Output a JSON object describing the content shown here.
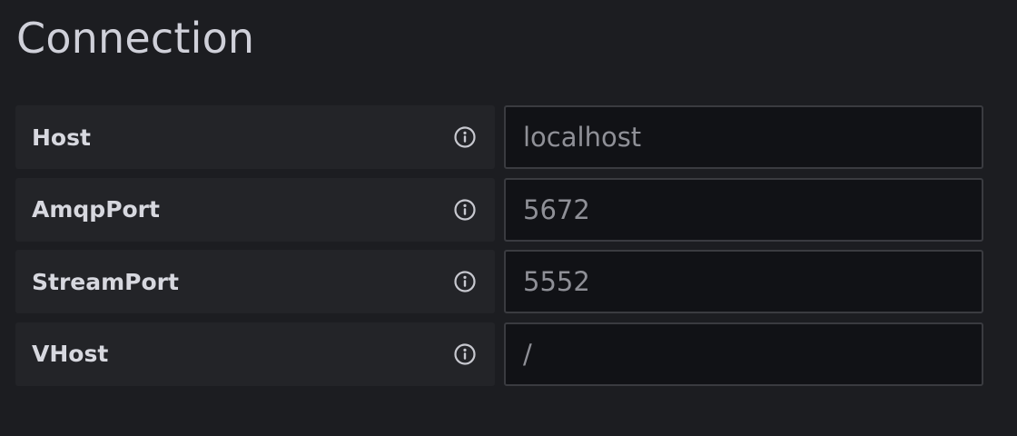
{
  "section": {
    "title": "Connection"
  },
  "fields": [
    {
      "label": "Host",
      "icon": "info-icon",
      "placeholder": "localhost"
    },
    {
      "label": "AmqpPort",
      "icon": "info-icon",
      "placeholder": "5672"
    },
    {
      "label": "StreamPort",
      "icon": "info-icon",
      "placeholder": "5552"
    },
    {
      "label": "VHost",
      "icon": "info-icon",
      "placeholder": "/"
    }
  ],
  "colors": {
    "background": "#1c1d21",
    "label_bg": "#232428",
    "input_bg": "#111216",
    "input_border": "#3a3b40",
    "title_text": "#cfd0d9",
    "label_text": "#d7d8df",
    "placeholder_text": "#8f9097"
  }
}
